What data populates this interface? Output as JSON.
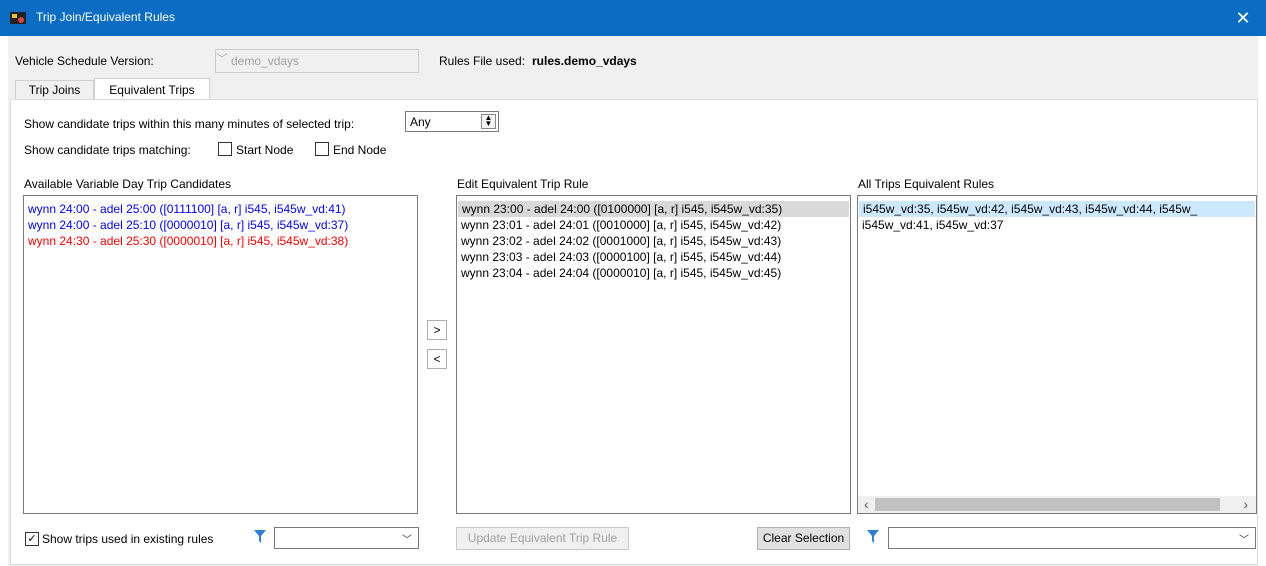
{
  "window": {
    "title": "Trip Join/Equivalent Rules",
    "close_glyph": "✕"
  },
  "header": {
    "version_label": "Vehicle Schedule Version:",
    "version_value": "demo_vdays",
    "rules_file_label": "Rules File used:",
    "rules_file_value": "rules.demo_vdays"
  },
  "tabs": [
    {
      "label": "Trip Joins"
    },
    {
      "label": "Equivalent Trips"
    }
  ],
  "options": {
    "minutes_label": "Show candidate trips within this many minutes of selected trip:",
    "minutes_value": "Any",
    "matching_label": "Show candidate trips matching:",
    "start_node_label": "Start Node",
    "end_node_label": "End Node"
  },
  "available": {
    "title": "Available Variable Day Trip Candidates",
    "items": [
      {
        "text": "wynn 24:00 - adel 25:00 ([0111100] [a, r] i545, i545w_vd:41)",
        "color": "#0000ff"
      },
      {
        "text": "wynn 24:00 - adel 25:10 ([0000010] [a, r] i545, i545w_vd:37)",
        "color": "#0000ff"
      },
      {
        "text": "wynn 24:30 - adel 25:30 ([0000010] [a, r] i545, i545w_vd:38)",
        "color": "#ff0000"
      }
    ],
    "show_used_label": "Show trips used in existing rules",
    "filter_value": ""
  },
  "move_buttons": {
    "add": ">",
    "remove": "<"
  },
  "edit": {
    "title": "Edit Equivalent Trip Rule",
    "items": [
      {
        "text": "wynn 23:00 - adel 24:00 ([0100000] [a, r] i545, i545w_vd:35)"
      },
      {
        "text": "wynn 23:01 - adel 24:01 ([0010000] [a, r] i545, i545w_vd:42)"
      },
      {
        "text": "wynn 23:02 - adel 24:02 ([0001000] [a, r] i545, i545w_vd:43)"
      },
      {
        "text": "wynn 23:03 - adel 24:03 ([0000100] [a, r] i545, i545w_vd:44)"
      },
      {
        "text": "wynn 23:04 - adel 24:04 ([0000010] [a, r] i545, i545w_vd:45)"
      }
    ],
    "update_label": "Update Equivalent Trip Rule",
    "clear_label": "Clear Selection"
  },
  "all_rules": {
    "title": "All Trips Equivalent Rules",
    "items": [
      {
        "text": "i545w_vd:35, i545w_vd:42, i545w_vd:43, i545w_vd:44, i545w_"
      },
      {
        "text": "i545w_vd:41, i545w_vd:37"
      }
    ],
    "scroll_left": "‹",
    "scroll_right": "›",
    "filter_value": ""
  },
  "colors": {
    "titlebar": "#0a6cc2",
    "selection_gray": "#d9d9d9",
    "selection_blue": "#cce8ff"
  }
}
